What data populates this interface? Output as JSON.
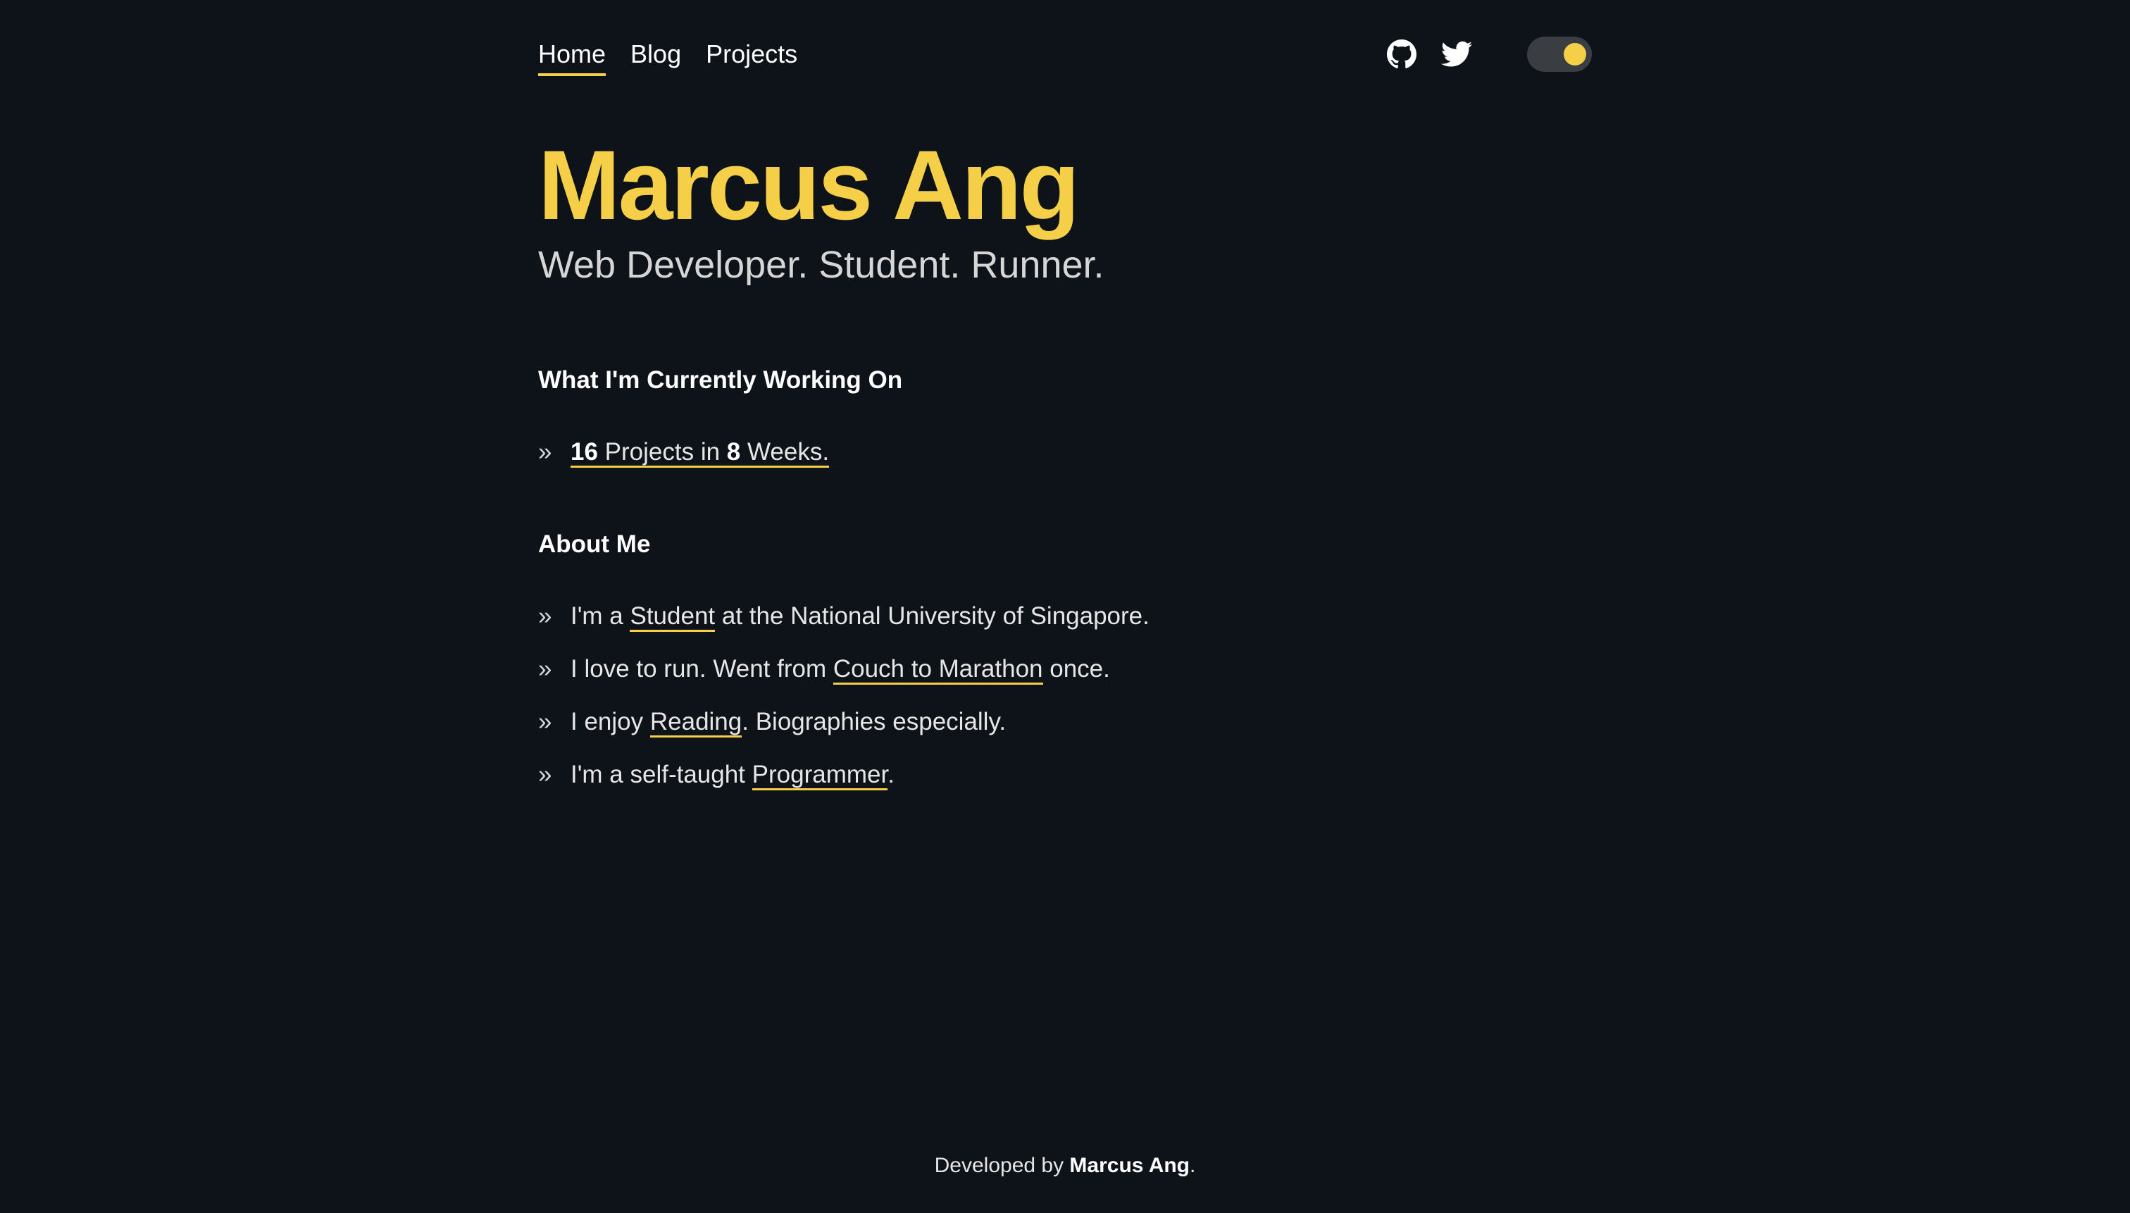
{
  "nav": {
    "links": [
      {
        "label": "Home",
        "active": true
      },
      {
        "label": "Blog",
        "active": false
      },
      {
        "label": "Projects",
        "active": false
      }
    ],
    "icons": [
      "github-icon",
      "twitter-icon"
    ],
    "theme_toggle": "on"
  },
  "hero": {
    "title": "Marcus Ang",
    "subtitle": "Web Developer. Student. Runner."
  },
  "working_on": {
    "heading": "What I'm Currently Working On",
    "bullet": "»",
    "item": {
      "num1": "16",
      "text1": " Projects in ",
      "num2": "8",
      "text2": " Weeks."
    }
  },
  "about": {
    "heading": "About Me",
    "bullet": "»",
    "items": [
      {
        "before": "I'm a ",
        "link": "Student",
        "after": " at the National University of Singapore."
      },
      {
        "before": "I love to run. Went from ",
        "link": "Couch to Marathon",
        "after": " once."
      },
      {
        "before": "I enjoy ",
        "link": "Reading",
        "after": ". Biographies especially."
      },
      {
        "before": "I'm a self-taught ",
        "link": "Programmer",
        "after": "."
      }
    ]
  },
  "footer": {
    "prefix": "Developed by ",
    "name": "Marcus Ang",
    "suffix": "."
  },
  "colors": {
    "background": "#0e131a",
    "accent": "#f5cf47",
    "text": "#e6e6e6",
    "toggle_track": "#3a3d42"
  }
}
